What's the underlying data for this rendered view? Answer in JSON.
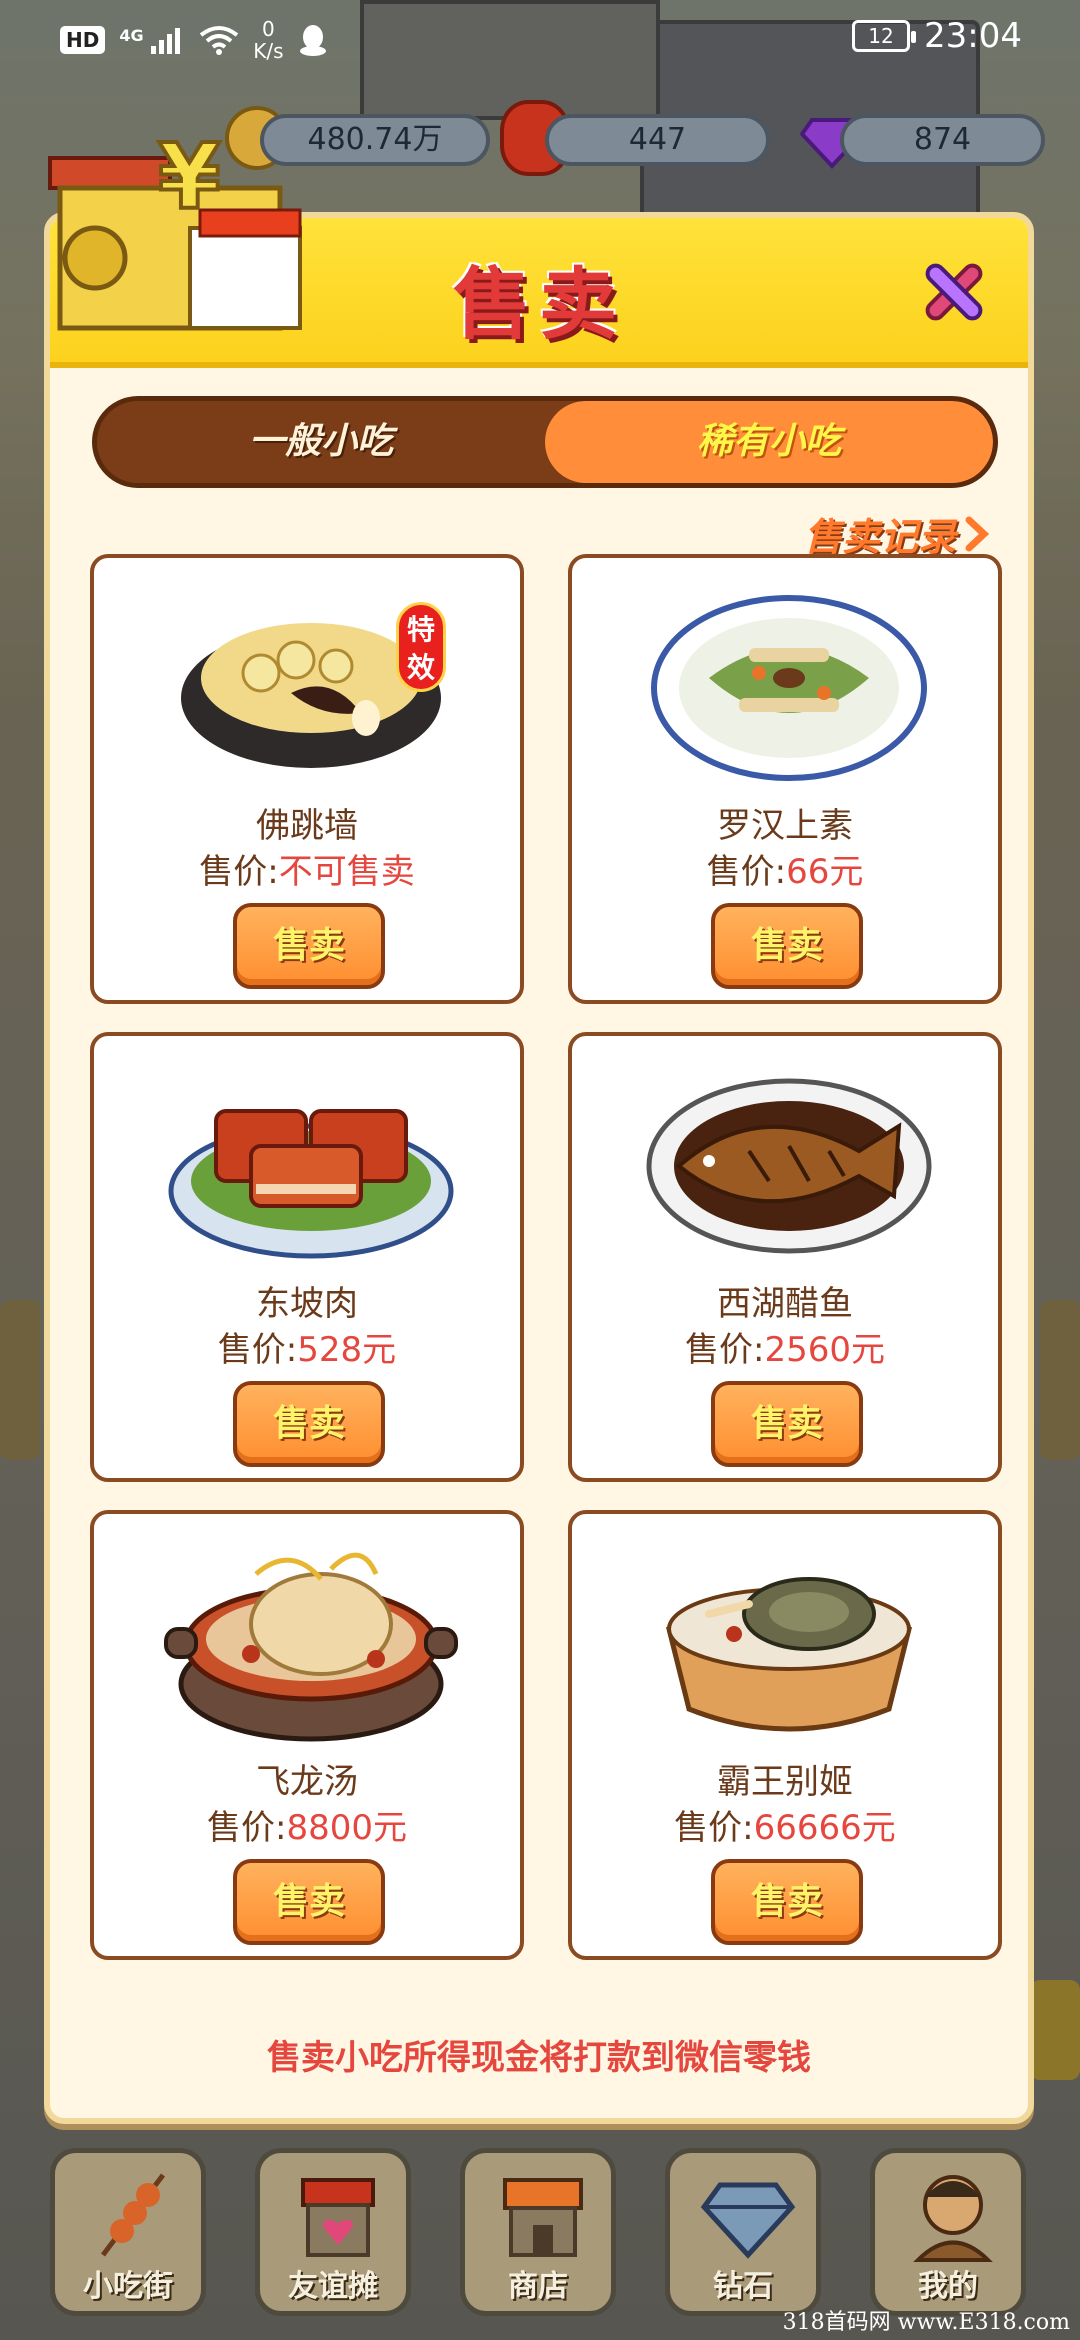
{
  "status_bar": {
    "hd": "HD",
    "network": "4G",
    "speed_value": "0",
    "speed_unit": "K/s",
    "battery": "12",
    "time": "23:04"
  },
  "currency": {
    "coins": "480.74万",
    "lanterns": "447",
    "diamonds": "874"
  },
  "dialog": {
    "title": "售卖",
    "tabs": [
      {
        "label": "一般小吃",
        "active": false
      },
      {
        "label": "稀有小吃",
        "active": true
      }
    ],
    "sales_log": "售卖记录",
    "dishes": [
      {
        "name": "佛跳墙",
        "price_label": "售价:",
        "price_value": "不可售卖",
        "badge": "特效",
        "sell": "售卖"
      },
      {
        "name": "罗汉上素",
        "price_label": "售价:",
        "price_value": "66元",
        "sell": "售卖"
      },
      {
        "name": "东坡肉",
        "price_label": "售价:",
        "price_value": "528元",
        "sell": "售卖"
      },
      {
        "name": "西湖醋鱼",
        "price_label": "售价:",
        "price_value": "2560元",
        "sell": "售卖"
      },
      {
        "name": "飞龙汤",
        "price_label": "售价:",
        "price_value": "8800元",
        "sell": "售卖"
      },
      {
        "name": "霸王别姬",
        "price_label": "售价:",
        "price_value": "66666元",
        "sell": "售卖"
      }
    ],
    "footer_note": "售卖小吃所得现金将打款到微信零钱"
  },
  "bottom_nav": [
    {
      "label": "小吃街",
      "icon": "skewer-icon"
    },
    {
      "label": "友谊摊",
      "icon": "stall-heart-icon"
    },
    {
      "label": "商店",
      "icon": "shop-icon"
    },
    {
      "label": "钻石",
      "icon": "diamond-icon"
    },
    {
      "label": "我的",
      "icon": "profile-icon"
    }
  ],
  "watermark": "318首码网 www.E318.com",
  "colors": {
    "header_yellow": "#fcd21d",
    "title_red": "#e23a39",
    "tab_brown": "#7a3d17",
    "tab_orange": "#ff8d3a",
    "price_red": "#e5473f",
    "card_border": "#8a4a22"
  }
}
